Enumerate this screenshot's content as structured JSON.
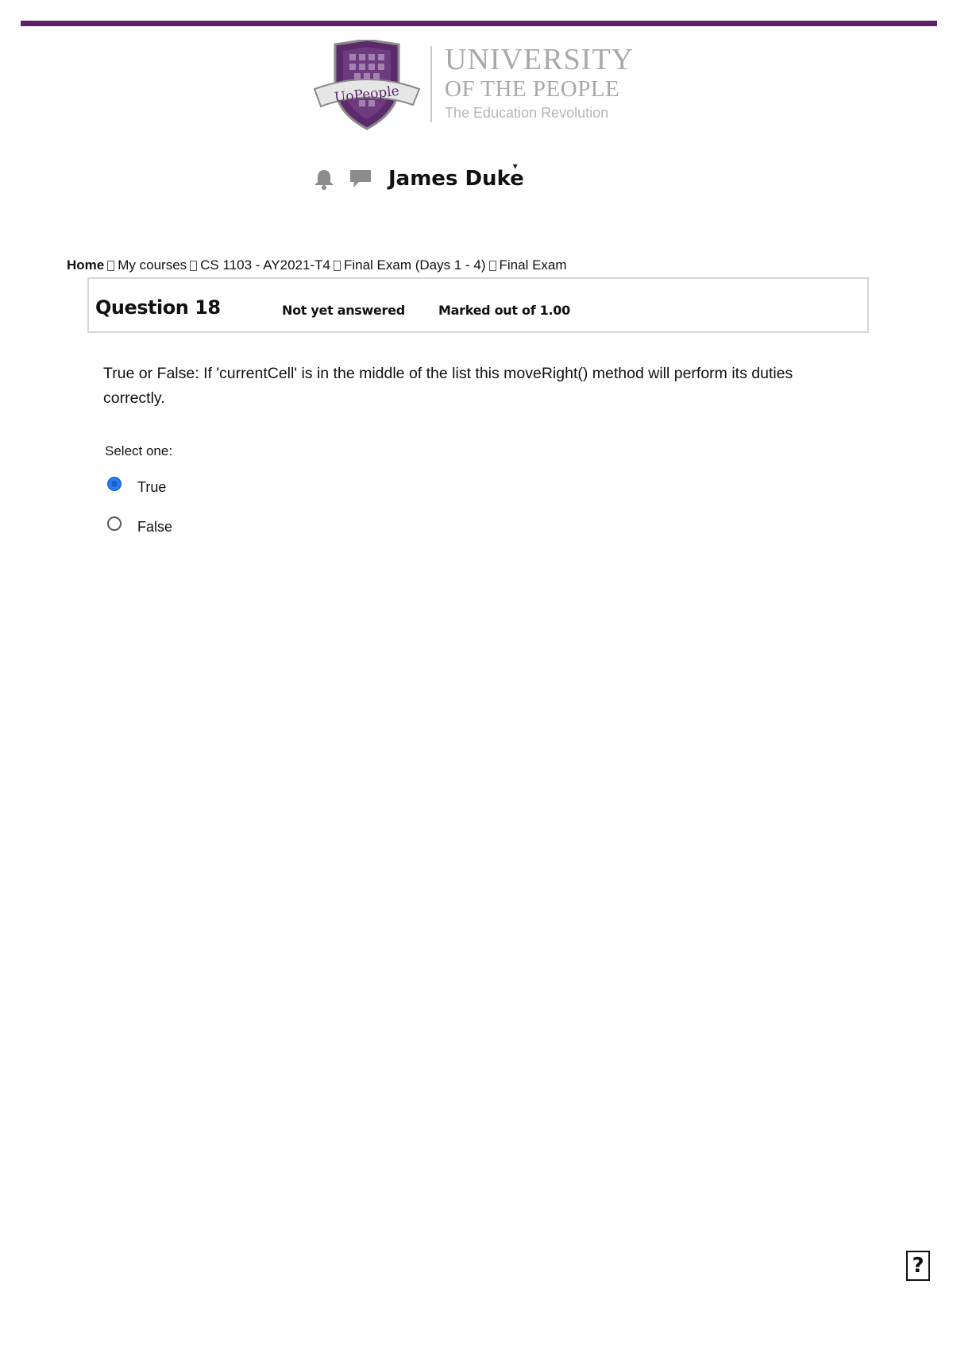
{
  "logo": {
    "shield_text": "UoPeople",
    "line1": "UNIVERSITY",
    "line2": "OF THE PEOPLE",
    "line3": "The Education Revolution"
  },
  "header": {
    "user_name": "James Duke",
    "caret": "▾"
  },
  "breadcrumb": {
    "items": [
      "Home",
      "My courses",
      "CS 1103 - AY2021-T4",
      "Final Exam (Days 1 - 4)",
      "Final Exam"
    ]
  },
  "question": {
    "title": "Question 18",
    "state": "Not yet answered",
    "grade": "Marked out of 1.00",
    "text": "True or False: If 'currentCell' is in the middle of the list this moveRight() method will perform its duties correctly.",
    "prompt": "Select one:",
    "options": [
      {
        "label": "True",
        "selected": true
      },
      {
        "label": "False",
        "selected": false
      }
    ]
  },
  "help_box": {
    "glyph": "?"
  },
  "colors": {
    "brand": "#5b1f6b",
    "radio_selected": "#2a7ff5"
  }
}
